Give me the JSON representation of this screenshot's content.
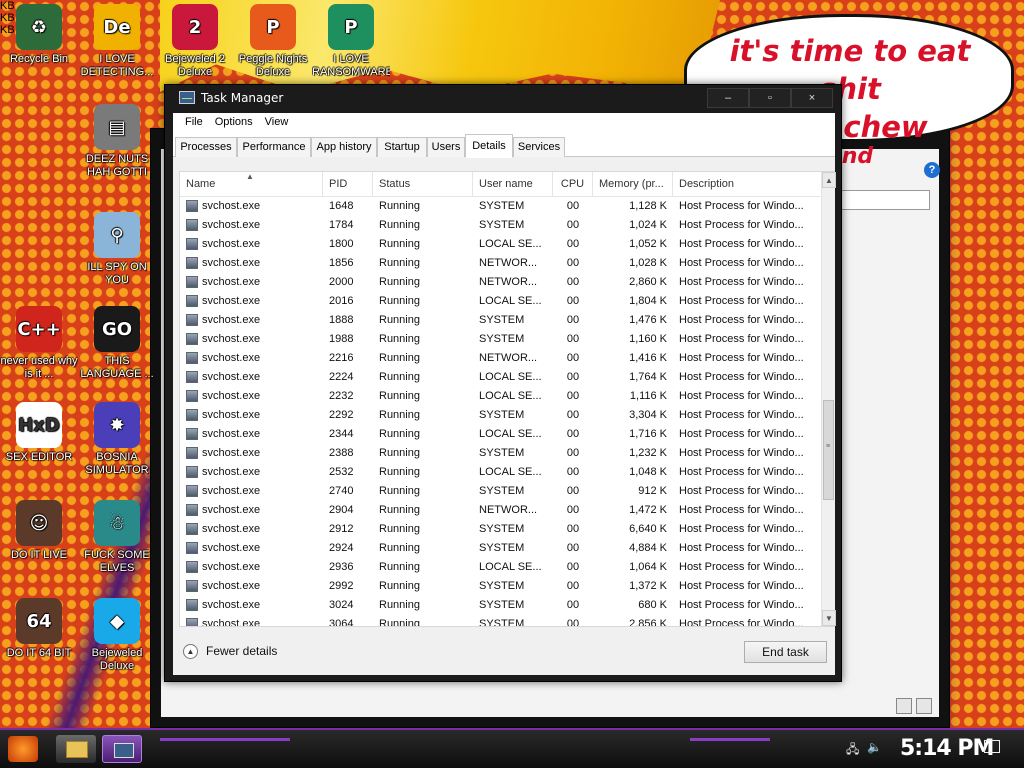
{
  "desktop": {
    "speech_bubble": {
      "line1": "it's time to eat shit",
      "line2": "and chew",
      "line3": "and"
    },
    "icons": [
      {
        "label": "Recycle Bin",
        "icon": "recycle-bin-icon",
        "color": "#2e6b3a",
        "glyph": "♻"
      },
      {
        "label": "I LOVE DETECTING...",
        "icon": "detect-it-easy-icon",
        "color": "#f0b100",
        "glyph": "De"
      },
      {
        "label": "Bejeweled 2 Deluxe",
        "icon": "bejeweled-2-icon",
        "color": "#c9183b",
        "glyph": "2"
      },
      {
        "label": "Peggle Nights Deluxe",
        "icon": "peggle-icon",
        "color": "#e85a1c",
        "glyph": "P"
      },
      {
        "label": "I LOVE RANSOMWARE",
        "icon": "ransomware-icon",
        "color": "#1e8f5e",
        "glyph": "P"
      },
      {
        "label": "DEEZ NUTS HAH GOTTI",
        "icon": "stacked-windows-icon",
        "color": "#7a7a7a",
        "glyph": "▤"
      },
      {
        "label": "ILL SPY ON YOU",
        "icon": "spy-magnifier-icon",
        "color": "#8ab4d8",
        "glyph": "⚲"
      },
      {
        "label": "never used why is it ...",
        "icon": "dev-cpp-icon",
        "color": "#d0251c",
        "glyph": "C++"
      },
      {
        "label": "THIS LANGUAGE ...",
        "icon": "goland-icon",
        "color": "#1a1a1a",
        "glyph": "GO"
      },
      {
        "label": "SEX EDITOR",
        "icon": "hxd-editor-icon",
        "color": "#ffffff",
        "glyph": "HxD"
      },
      {
        "label": "BOSNIA SIMULATOR",
        "icon": "mine-bomb-icon",
        "color": "#4a3fb8",
        "glyph": "✸"
      },
      {
        "label": "DO IT LIVE",
        "icon": "portrait-icon",
        "color": "#5b3a2a",
        "glyph": "☺"
      },
      {
        "label": "FUCK SOME ELVES",
        "icon": "santa-icon",
        "color": "#2a8a8a",
        "glyph": "☃"
      },
      {
        "label": "DO IT 64 BIT",
        "icon": "portrait-64-icon",
        "color": "#5b3a2a",
        "glyph": "64"
      },
      {
        "label": "Bejeweled Deluxe",
        "icon": "blue-gem-icon",
        "color": "#19a8e8",
        "glyph": "◆"
      }
    ]
  },
  "background_window": {
    "size_labels": [
      "KB",
      "KB",
      "KB"
    ],
    "help": "?"
  },
  "task_manager": {
    "title": "Task Manager",
    "window_controls": {
      "minimize": "–",
      "maximize": "▫",
      "close": "×"
    },
    "menu": [
      "File",
      "Options",
      "View"
    ],
    "tabs": [
      "Processes",
      "Performance",
      "App history",
      "Startup",
      "Users",
      "Details",
      "Services"
    ],
    "active_tab": "Details",
    "columns": [
      "Name",
      "PID",
      "Status",
      "User name",
      "CPU",
      "Memory (pr...",
      "Description"
    ],
    "sort_indicator": "▲",
    "rows": [
      [
        "svchost.exe",
        "1648",
        "Running",
        "SYSTEM",
        "00",
        "1,128 K",
        "Host Process for Windo..."
      ],
      [
        "svchost.exe",
        "1784",
        "Running",
        "SYSTEM",
        "00",
        "1,024 K",
        "Host Process for Windo..."
      ],
      [
        "svchost.exe",
        "1800",
        "Running",
        "LOCAL SE...",
        "00",
        "1,052 K",
        "Host Process for Windo..."
      ],
      [
        "svchost.exe",
        "1856",
        "Running",
        "NETWOR...",
        "00",
        "1,028 K",
        "Host Process for Windo..."
      ],
      [
        "svchost.exe",
        "2000",
        "Running",
        "NETWOR...",
        "00",
        "2,860 K",
        "Host Process for Windo..."
      ],
      [
        "svchost.exe",
        "2016",
        "Running",
        "LOCAL SE...",
        "00",
        "1,804 K",
        "Host Process for Windo..."
      ],
      [
        "svchost.exe",
        "1888",
        "Running",
        "SYSTEM",
        "00",
        "1,476 K",
        "Host Process for Windo..."
      ],
      [
        "svchost.exe",
        "1988",
        "Running",
        "SYSTEM",
        "00",
        "1,160 K",
        "Host Process for Windo..."
      ],
      [
        "svchost.exe",
        "2216",
        "Running",
        "NETWOR...",
        "00",
        "1,416 K",
        "Host Process for Windo..."
      ],
      [
        "svchost.exe",
        "2224",
        "Running",
        "LOCAL SE...",
        "00",
        "1,764 K",
        "Host Process for Windo..."
      ],
      [
        "svchost.exe",
        "2232",
        "Running",
        "LOCAL SE...",
        "00",
        "1,116 K",
        "Host Process for Windo..."
      ],
      [
        "svchost.exe",
        "2292",
        "Running",
        "SYSTEM",
        "00",
        "3,304 K",
        "Host Process for Windo..."
      ],
      [
        "svchost.exe",
        "2344",
        "Running",
        "LOCAL SE...",
        "00",
        "1,716 K",
        "Host Process for Windo..."
      ],
      [
        "svchost.exe",
        "2388",
        "Running",
        "SYSTEM",
        "00",
        "1,232 K",
        "Host Process for Windo..."
      ],
      [
        "svchost.exe",
        "2532",
        "Running",
        "LOCAL SE...",
        "00",
        "1,048 K",
        "Host Process for Windo..."
      ],
      [
        "svchost.exe",
        "2740",
        "Running",
        "SYSTEM",
        "00",
        "912 K",
        "Host Process for Windo..."
      ],
      [
        "svchost.exe",
        "2904",
        "Running",
        "NETWOR...",
        "00",
        "1,472 K",
        "Host Process for Windo..."
      ],
      [
        "svchost.exe",
        "2912",
        "Running",
        "SYSTEM",
        "00",
        "6,640 K",
        "Host Process for Windo..."
      ],
      [
        "svchost.exe",
        "2924",
        "Running",
        "SYSTEM",
        "00",
        "4,884 K",
        "Host Process for Windo..."
      ],
      [
        "svchost.exe",
        "2936",
        "Running",
        "LOCAL SE...",
        "00",
        "1,064 K",
        "Host Process for Windo..."
      ],
      [
        "svchost.exe",
        "2992",
        "Running",
        "SYSTEM",
        "00",
        "1,372 K",
        "Host Process for Windo..."
      ],
      [
        "svchost.exe",
        "3024",
        "Running",
        "SYSTEM",
        "00",
        "680 K",
        "Host Process for Windo..."
      ],
      [
        "svchost.exe",
        "3064",
        "Running",
        "SYSTEM",
        "00",
        "2,856 K",
        "Host Process for Windo..."
      ]
    ],
    "fewer_details": "Fewer details",
    "end_task": "End task"
  },
  "taskbar": {
    "clock": "5:14 PM"
  },
  "colors": {
    "accent_purple": "#7a2ea4",
    "desktop_orange": "#d8401a",
    "dot_yellow": "#f6a11e",
    "speech_red": "#d8102a"
  }
}
